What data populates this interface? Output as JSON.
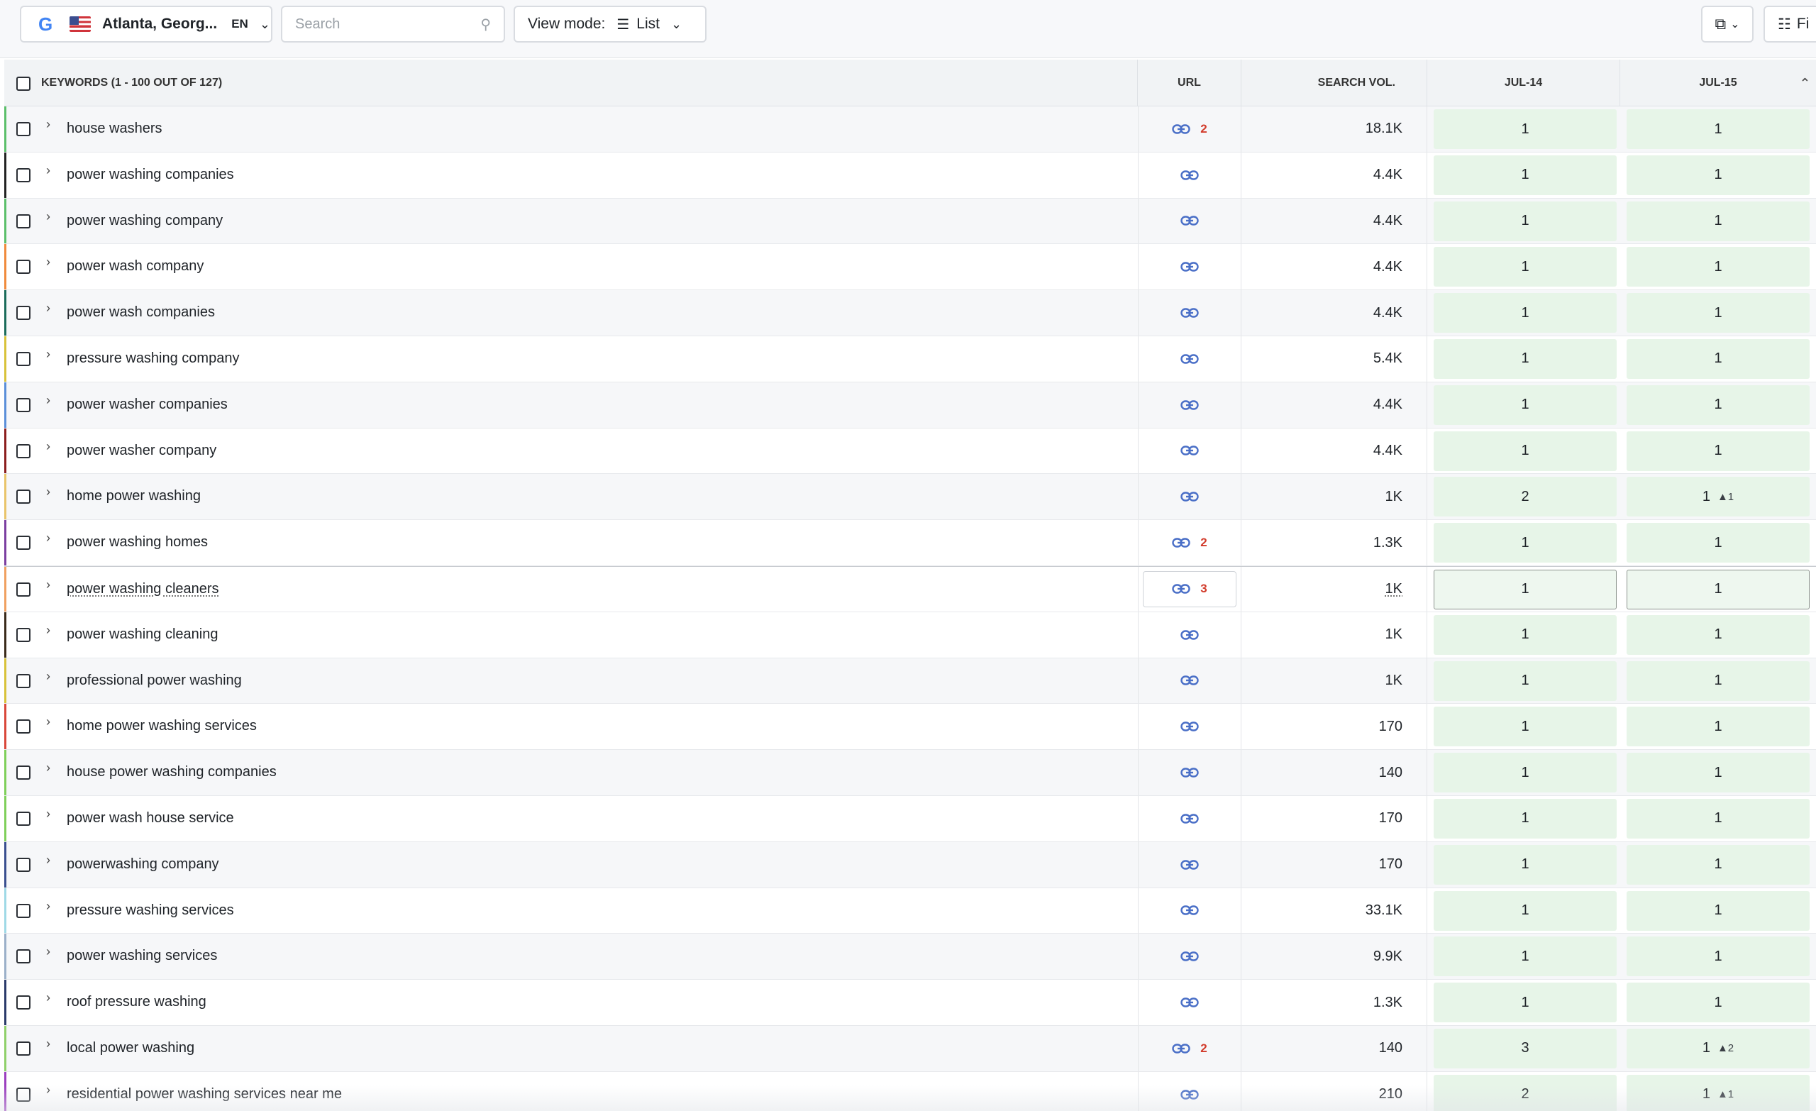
{
  "toolbar": {
    "engine_icon": "G",
    "location": "Atlanta, Georg...",
    "language": "EN",
    "search_placeholder": "Search",
    "view_mode_label": "View mode:",
    "view_mode_value": "List",
    "filter_label": "Fi"
  },
  "table": {
    "headers": {
      "keywords": "KEYWORDS (1 - 100 OUT OF 127)",
      "url": "URL",
      "search_vol": "SEARCH VOL.",
      "date1": "JUL-14",
      "date2": "JUL-15"
    },
    "rows": [
      {
        "keyword": "house washers",
        "url_count": "2",
        "volume": "18.1K",
        "jul14": "1",
        "jul15": "1",
        "change": "",
        "color": "#5bbf6a"
      },
      {
        "keyword": "power washing companies",
        "url_count": "",
        "volume": "4.4K",
        "jul14": "1",
        "jul15": "1",
        "change": "",
        "color": "#222222"
      },
      {
        "keyword": "power washing company",
        "url_count": "",
        "volume": "4.4K",
        "jul14": "1",
        "jul15": "1",
        "change": "",
        "color": "#5bbf6a"
      },
      {
        "keyword": "power wash company",
        "url_count": "",
        "volume": "4.4K",
        "jul14": "1",
        "jul15": "1",
        "change": "",
        "color": "#f08a3c"
      },
      {
        "keyword": "power wash companies",
        "url_count": "",
        "volume": "4.4K",
        "jul14": "1",
        "jul15": "1",
        "change": "",
        "color": "#1a6b5a"
      },
      {
        "keyword": "pressure washing company",
        "url_count": "",
        "volume": "5.4K",
        "jul14": "1",
        "jul15": "1",
        "change": "",
        "color": "#d8c23a"
      },
      {
        "keyword": "power washer companies",
        "url_count": "",
        "volume": "4.4K",
        "jul14": "1",
        "jul15": "1",
        "change": "",
        "color": "#5b8fd9"
      },
      {
        "keyword": "power washer company",
        "url_count": "",
        "volume": "4.4K",
        "jul14": "1",
        "jul15": "1",
        "change": "",
        "color": "#8b1e1e"
      },
      {
        "keyword": "home power washing",
        "url_count": "",
        "volume": "1K",
        "jul14": "2",
        "jul15": "1",
        "change": "▲1",
        "color": "#e9c46a"
      },
      {
        "keyword": "power washing homes",
        "url_count": "2",
        "volume": "1.3K",
        "jul14": "1",
        "jul15": "1",
        "change": "",
        "color": "#7b3fa0"
      },
      {
        "keyword": "power washing cleaners",
        "url_count": "3",
        "volume": "1K",
        "jul14": "1",
        "jul15": "1",
        "change": "",
        "color": "#f0a060"
      },
      {
        "keyword": "power washing cleaning",
        "url_count": "",
        "volume": "1K",
        "jul14": "1",
        "jul15": "1",
        "change": "",
        "color": "#3a2a1a"
      },
      {
        "keyword": "professional power washing",
        "url_count": "",
        "volume": "1K",
        "jul14": "1",
        "jul15": "1",
        "change": "",
        "color": "#d8c23a"
      },
      {
        "keyword": "home power washing services",
        "url_count": "",
        "volume": "170",
        "jul14": "1",
        "jul15": "1",
        "change": "",
        "color": "#d9473a"
      },
      {
        "keyword": "house power washing companies",
        "url_count": "",
        "volume": "140",
        "jul14": "1",
        "jul15": "1",
        "change": "",
        "color": "#7fcf5a"
      },
      {
        "keyword": "power wash house service",
        "url_count": "",
        "volume": "170",
        "jul14": "1",
        "jul15": "1",
        "change": "",
        "color": "#7fcf5a"
      },
      {
        "keyword": "powerwashing company",
        "url_count": "",
        "volume": "170",
        "jul14": "1",
        "jul15": "1",
        "change": "",
        "color": "#3a4f8f"
      },
      {
        "keyword": "pressure washing services",
        "url_count": "",
        "volume": "33.1K",
        "jul14": "1",
        "jul15": "1",
        "change": "",
        "color": "#9fd9e6"
      },
      {
        "keyword": "power washing services",
        "url_count": "",
        "volume": "9.9K",
        "jul14": "1",
        "jul15": "1",
        "change": "",
        "color": "#9bb0c9"
      },
      {
        "keyword": "roof pressure washing",
        "url_count": "",
        "volume": "1.3K",
        "jul14": "1",
        "jul15": "1",
        "change": "",
        "color": "#2a3a6a"
      },
      {
        "keyword": "local power washing",
        "url_count": "2",
        "volume": "140",
        "jul14": "3",
        "jul15": "1",
        "change": "▲2",
        "color": "#8fd06a"
      },
      {
        "keyword": "residential power washing services near me",
        "url_count": "",
        "volume": "210",
        "jul14": "2",
        "jul15": "1",
        "change": "▲1",
        "color": "#9b3fbf"
      }
    ]
  },
  "colors": {
    "accent_link": "#4a6fc7",
    "position_bg": "#e7f5e8",
    "url_count": "#d23b2b"
  }
}
